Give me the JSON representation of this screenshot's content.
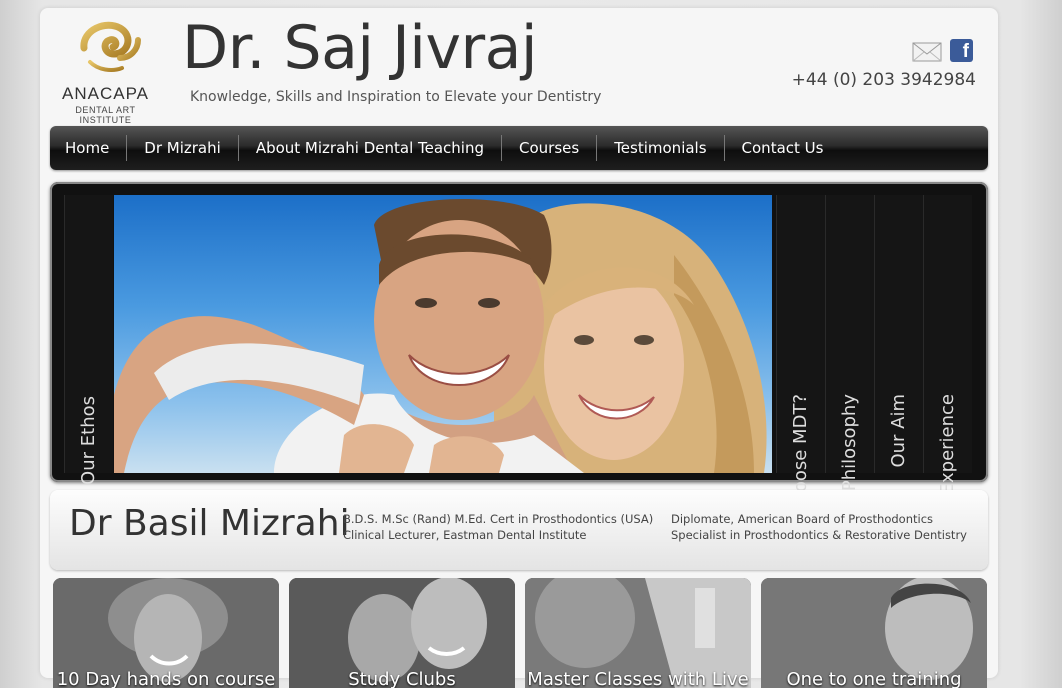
{
  "header": {
    "logo_name": "ANACAPA",
    "logo_sub": "DENTAL ART INSTITUTE",
    "title": "Dr. Saj Jivraj",
    "tagline": "Knowledge, Skills and Inspiration to Elevate your Dentistry",
    "phone": "+44 (0) 203 3942984"
  },
  "nav": [
    "Home",
    "Dr Mizrahi",
    "About Mizrahi Dental Teaching",
    "Courses",
    "Testimonials",
    "Contact Us"
  ],
  "slider": {
    "left_tab": "Our Ethos",
    "right_tabs": [
      "Why Choose MDT?",
      "Our Philosophy",
      "Our Aim",
      "Your Experience"
    ]
  },
  "profile": {
    "name": "Dr Basil Mizrahi",
    "cred_left": [
      "B.D.S. M.Sc (Rand) M.Ed. Cert in Prosthodontics (USA)",
      "Clinical Lecturer, Eastman Dental Institute"
    ],
    "cred_right": [
      "Diplomate, American Board of Prosthodontics",
      "Specialist in Prosthodontics & Restorative Dentistry"
    ]
  },
  "tiles": [
    "10 Day hands on course",
    "Study Clubs",
    "Master Classes with Live",
    "One to one training"
  ],
  "colors": {
    "facebook": "#3b5b99",
    "logo_gold": "#c9a44a",
    "nav_bg": "#1e1e1e"
  }
}
